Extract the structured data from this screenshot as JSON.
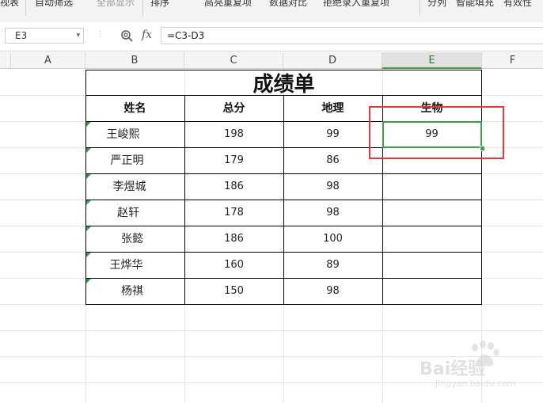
{
  "ribbon": {
    "items": [
      "视表",
      "自动筛选",
      "全部显示",
      "排序",
      "高亮重复项",
      "数据对比",
      "拒绝录入重复项",
      "分列",
      "智能填充",
      "有效性"
    ]
  },
  "formula_bar": {
    "name_box": "E3",
    "fx_label": "fx",
    "formula": "=C3-D3"
  },
  "columns": [
    "A",
    "B",
    "C",
    "D",
    "E",
    "F"
  ],
  "active_column": "E",
  "sheet": {
    "title": "成绩单",
    "headers": [
      "姓名",
      "总分",
      "地理",
      "生物"
    ],
    "rows": [
      {
        "name": "王峻熙",
        "total": "198",
        "geo": "99",
        "bio": "99"
      },
      {
        "name": "严正明",
        "total": "179",
        "geo": "86",
        "bio": ""
      },
      {
        "name": "李煜城",
        "total": "186",
        "geo": "98",
        "bio": ""
      },
      {
        "name": "赵轩",
        "total": "178",
        "geo": "98",
        "bio": ""
      },
      {
        "name": "张懿",
        "total": "186",
        "geo": "100",
        "bio": ""
      },
      {
        "name": "王烨华",
        "total": "160",
        "geo": "89",
        "bio": ""
      },
      {
        "name": "杨祺",
        "total": "150",
        "geo": "98",
        "bio": ""
      }
    ]
  },
  "watermark": {
    "brand": "Bai经验",
    "sub": "jingyan.baidu.com"
  },
  "colors": {
    "selection": "#3aa04a",
    "highlight_box": "#e53935"
  }
}
